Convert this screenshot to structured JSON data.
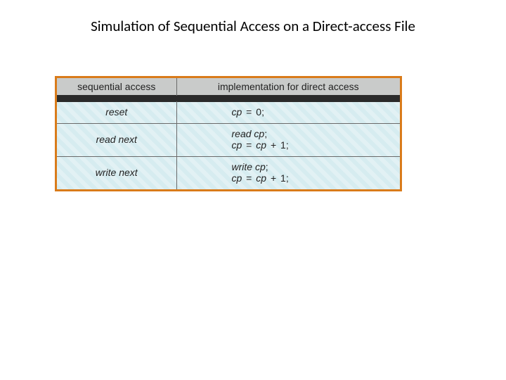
{
  "title": "Simulation of Sequential Access on a Direct-access File",
  "headers": {
    "left": "sequential access",
    "right": "implementation for direct access"
  },
  "rows": [
    {
      "seq": "reset",
      "impl": [
        "cp = 0;"
      ]
    },
    {
      "seq": "read next",
      "impl": [
        "read cp;",
        "cp = cp + 1;"
      ]
    },
    {
      "seq": "write next",
      "impl": [
        "write cp;",
        "cp = cp + 1;"
      ]
    }
  ],
  "chart_data": {
    "type": "table",
    "title": "Simulation of Sequential Access on a Direct-access File",
    "columns": [
      "sequential access",
      "implementation for direct access"
    ],
    "rows": [
      [
        "reset",
        "cp = 0;"
      ],
      [
        "read next",
        "read cp; cp = cp + 1;"
      ],
      [
        "write next",
        "write cp; cp = cp + 1;"
      ]
    ]
  }
}
